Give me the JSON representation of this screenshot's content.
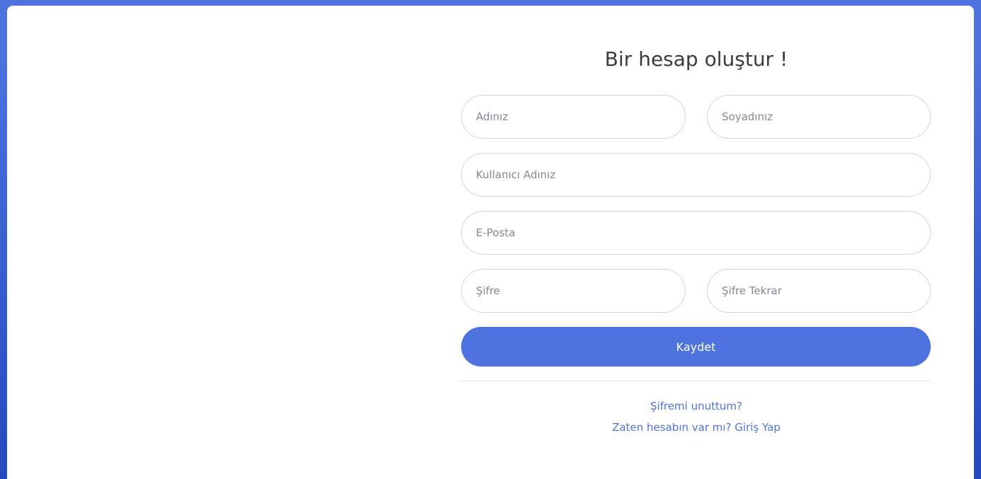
{
  "form": {
    "title": "Bir hesap oluştur !",
    "fields": {
      "first_name_placeholder": "Adınız",
      "last_name_placeholder": "Soyadınız",
      "username_placeholder": "Kullanıcı Adınız",
      "email_placeholder": "E-Posta",
      "password_placeholder": "Şifre",
      "password_repeat_placeholder": "Şifre Tekrar"
    },
    "submit_label": "Kaydet",
    "links": {
      "forgot_password": "Şifremi unuttum?",
      "login": "Zaten hesabın var mı? Giriş Yap"
    }
  },
  "colors": {
    "primary": "#4e73df",
    "background_gradient_start": "#4e73df",
    "background_gradient_end": "#224abe",
    "card": "#ffffff",
    "title_text": "#3a3b45"
  }
}
